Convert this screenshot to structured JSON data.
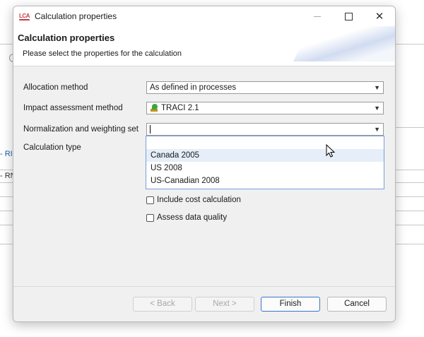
{
  "background": {
    "fragment_1": "- RI",
    "fragment_2": "- RN"
  },
  "window": {
    "app_icon_text": "LCA",
    "title": "Calculation properties",
    "minimize_icon": "minimize-icon",
    "maximize_icon": "maximize-icon",
    "close_icon": "close-icon",
    "close_glyph": "✕"
  },
  "header": {
    "title": "Calculation properties",
    "description": "Please select the properties for the calculation"
  },
  "form": {
    "allocation": {
      "label": "Allocation method",
      "value": "As defined in processes"
    },
    "impact": {
      "label": "Impact assessment method",
      "value": "TRACI 2.1",
      "icon": "traci-leaf-icon"
    },
    "normalization": {
      "label": "Normalization and weighting set",
      "value": ""
    },
    "calc_type": {
      "label": "Calculation type"
    },
    "dropdown_arrow": "▼",
    "dropdown_options": [
      "Canada 2005",
      "US 2008",
      "US-Canadian 2008"
    ],
    "checkboxes": {
      "cost": "Include cost calculation",
      "quality": "Assess data quality"
    }
  },
  "footer": {
    "back": "< Back",
    "next": "Next >",
    "finish": "Finish",
    "cancel": "Cancel"
  },
  "colors": {
    "accent": "#3b76c9",
    "hover": "#e5eef9",
    "dialog_bg": "#f0f0f0"
  }
}
